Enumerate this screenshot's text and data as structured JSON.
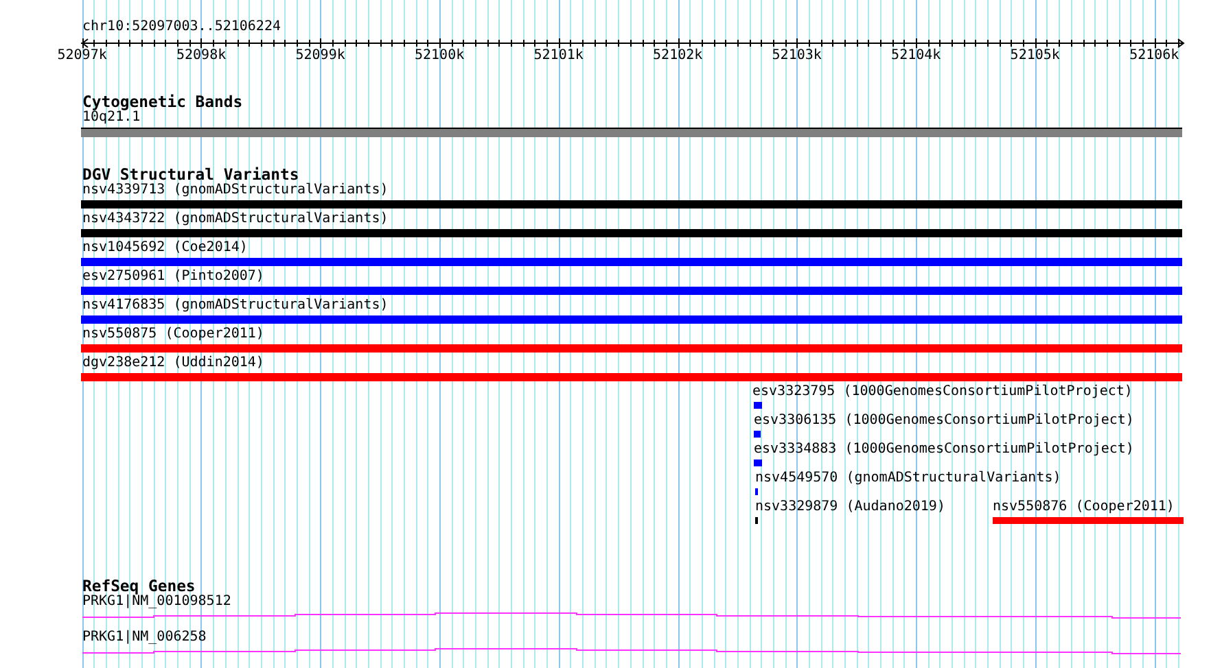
{
  "ruler": {
    "location": "chr10:52097003..52106224",
    "tick_labels": [
      "52097k",
      "52098k",
      "52099k",
      "52100k",
      "52101k",
      "52102k",
      "52103k",
      "52104k",
      "52105k",
      "52106k"
    ]
  },
  "cytogenetic_bands": {
    "title": "Cytogenetic Bands",
    "features": [
      {
        "label": "10q21.1"
      }
    ]
  },
  "dgv_structural_variants": {
    "title": "DGV Structural Variants",
    "features": [
      {
        "label": "nsv4339713 (gnomADStructuralVariants)",
        "color": "#000000"
      },
      {
        "label": "nsv4343722 (gnomADStructuralVariants)",
        "color": "#000000"
      },
      {
        "label": "nsv1045692 (Coe2014)",
        "color": "#0000ff"
      },
      {
        "label": "esv2750961 (Pinto2007)",
        "color": "#0000ff"
      },
      {
        "label": "nsv4176835 (gnomADStructuralVariants)",
        "color": "#0000ff"
      },
      {
        "label": "nsv550875 (Cooper2011)",
        "color": "#ff0000"
      },
      {
        "label": "dgv238e212 (Uddin2014)",
        "color": "#ff0000"
      },
      {
        "label": "esv3323795 (1000GenomesConsortiumPilotProject)",
        "color": "#0000ff"
      },
      {
        "label": "esv3306135 (1000GenomesConsortiumPilotProject)",
        "color": "#0000ff"
      },
      {
        "label": "esv3334883 (1000GenomesConsortiumPilotProject)",
        "color": "#0000ff"
      },
      {
        "label": "nsv4549570 (gnomADStructuralVariants)",
        "color": "#0000ff"
      },
      {
        "label": "nsv3329879 (Audano2019)",
        "color": "#000000"
      },
      {
        "label": "nsv550876 (Cooper2011)",
        "color": "#ff0000"
      }
    ]
  },
  "refseq_genes": {
    "title": "RefSeq Genes",
    "features": [
      {
        "label": "PRKG1|NM_001098512"
      },
      {
        "label": "PRKG1|NM_006258"
      }
    ]
  }
}
